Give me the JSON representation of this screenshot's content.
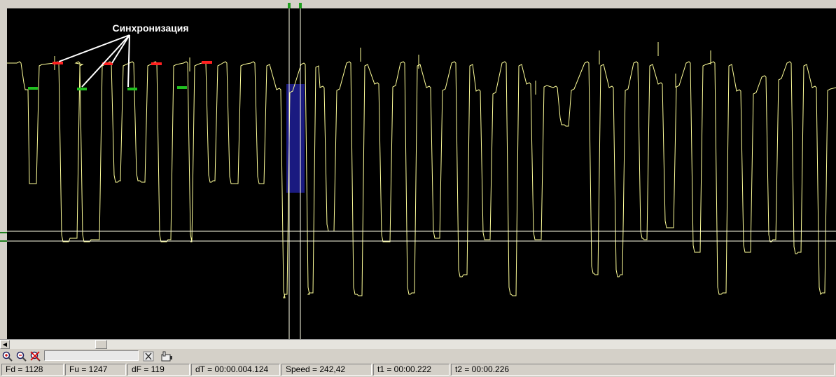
{
  "plot": {
    "annotation": "Синхронизация",
    "colors": {
      "background": "#000000",
      "signal": "#ffff99",
      "cursor": "#ffffe8",
      "sync_high": "#ff2020",
      "sync_low": "#20c020",
      "selection": "#1a1a80"
    }
  },
  "toolbar": {
    "icons": [
      "zoom-in-icon",
      "zoom-out-icon",
      "zoom-reset-icon",
      "clear-icon",
      "hand-pointer-icon"
    ]
  },
  "status": {
    "fd": "Fd = 1128",
    "fu": "Fu = 1247",
    "df": "dF = 119",
    "dt": "dT = 00:00.004.124",
    "speed": "Speed = 242,42",
    "t1": "t1 = 00:00.222",
    "t2": "t2 = 00:00.226"
  }
}
